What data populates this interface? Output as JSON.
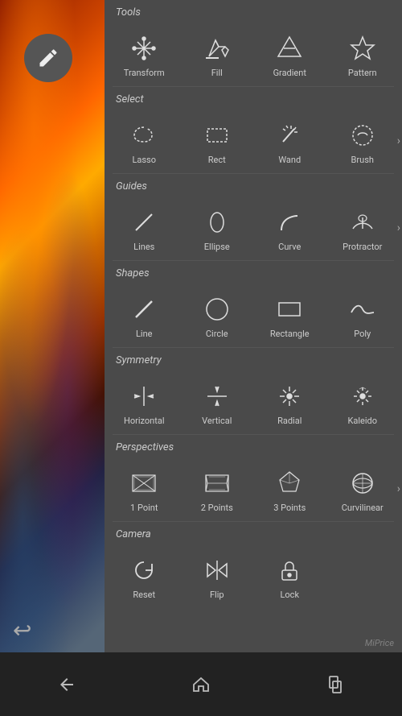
{
  "panel": {
    "sections": [
      {
        "label": "Tools",
        "items": [
          {
            "name": "Transform",
            "icon": "transform"
          },
          {
            "name": "Fill",
            "icon": "fill"
          },
          {
            "name": "Gradient",
            "icon": "gradient"
          },
          {
            "name": "Pattern",
            "icon": "pattern"
          }
        ],
        "hasArrow": false
      },
      {
        "label": "Select",
        "items": [
          {
            "name": "Lasso",
            "icon": "lasso"
          },
          {
            "name": "Rect",
            "icon": "rect"
          },
          {
            "name": "Wand",
            "icon": "wand"
          },
          {
            "name": "Brush",
            "icon": "brush-select"
          }
        ],
        "hasArrow": true
      },
      {
        "label": "Guides",
        "items": [
          {
            "name": "Lines",
            "icon": "lines"
          },
          {
            "name": "Ellipse",
            "icon": "ellipse"
          },
          {
            "name": "Curve",
            "icon": "curve"
          },
          {
            "name": "Protractor",
            "icon": "protractor"
          }
        ],
        "hasArrow": true
      },
      {
        "label": "Shapes",
        "items": [
          {
            "name": "Line",
            "icon": "line"
          },
          {
            "name": "Circle",
            "icon": "circle"
          },
          {
            "name": "Rectangle",
            "icon": "rectangle"
          },
          {
            "name": "Poly",
            "icon": "poly"
          }
        ],
        "hasArrow": false
      },
      {
        "label": "Symmetry",
        "items": [
          {
            "name": "Horizontal",
            "icon": "horizontal"
          },
          {
            "name": "Vertical",
            "icon": "vertical"
          },
          {
            "name": "Radial",
            "icon": "radial"
          },
          {
            "name": "Kaleido",
            "icon": "kaleido"
          }
        ],
        "hasArrow": false
      },
      {
        "label": "Perspectives",
        "items": [
          {
            "name": "1 Point",
            "icon": "one-point"
          },
          {
            "name": "2 Points",
            "icon": "two-points"
          },
          {
            "name": "3 Points",
            "icon": "three-points"
          },
          {
            "name": "Curvilinear",
            "icon": "curvilinear"
          }
        ],
        "hasArrow": true
      },
      {
        "label": "Camera",
        "items": [
          {
            "name": "Reset",
            "icon": "reset"
          },
          {
            "name": "Flip",
            "icon": "flip"
          },
          {
            "name": "Lock",
            "icon": "lock"
          }
        ],
        "hasArrow": false
      }
    ]
  },
  "bottom_nav": {
    "items": [
      "back",
      "home",
      "recents"
    ]
  }
}
